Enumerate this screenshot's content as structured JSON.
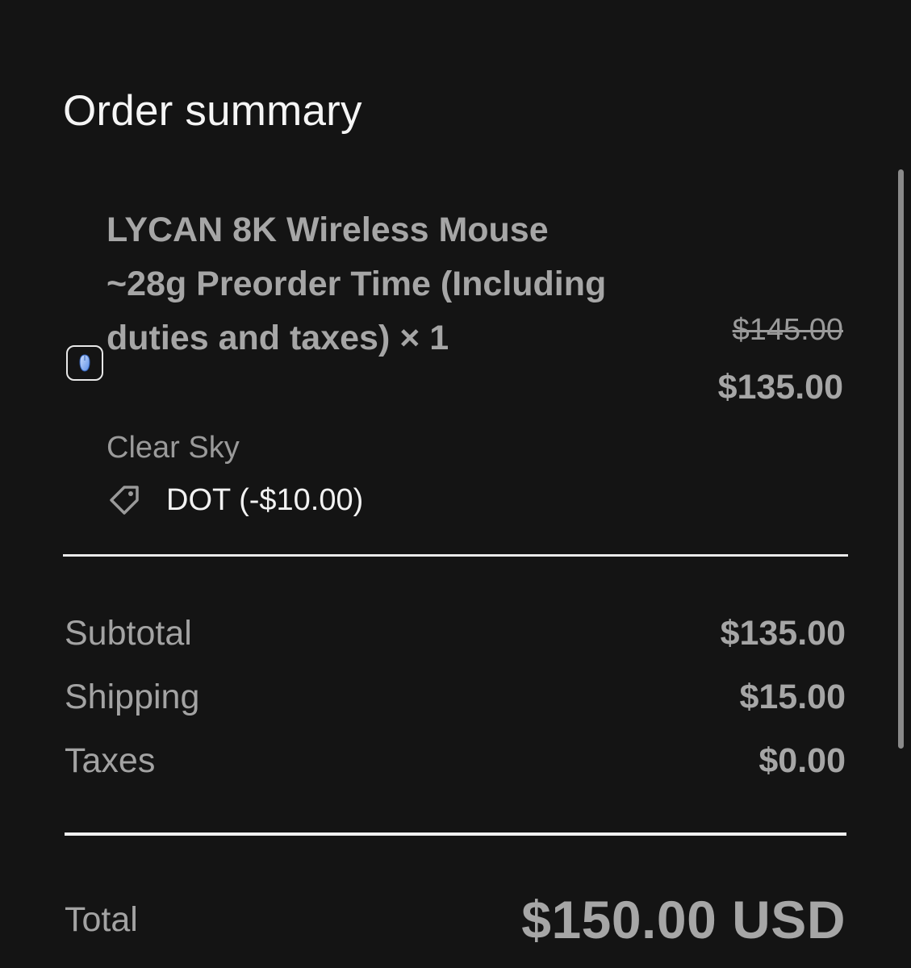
{
  "title": "Order summary",
  "line_item": {
    "name": "LYCAN 8K Wireless Mouse ~28g Preorder Time (Including duties and taxes) × 1",
    "variant": "Clear Sky",
    "discount_code": "DOT (-$10.00)",
    "original_price": "$145.00",
    "price": "$135.00",
    "thumbnail_icon": "mouse-icon"
  },
  "summary": {
    "subtotal_label": "Subtotal",
    "subtotal_value": "$135.00",
    "shipping_label": "Shipping",
    "shipping_value": "$15.00",
    "taxes_label": "Taxes",
    "taxes_value": "$0.00"
  },
  "total": {
    "label": "Total",
    "value": "$150.00 USD"
  },
  "colors": {
    "background": "#141414",
    "primary_text": "#f2f2f2",
    "muted_text": "#a6a6a6"
  }
}
